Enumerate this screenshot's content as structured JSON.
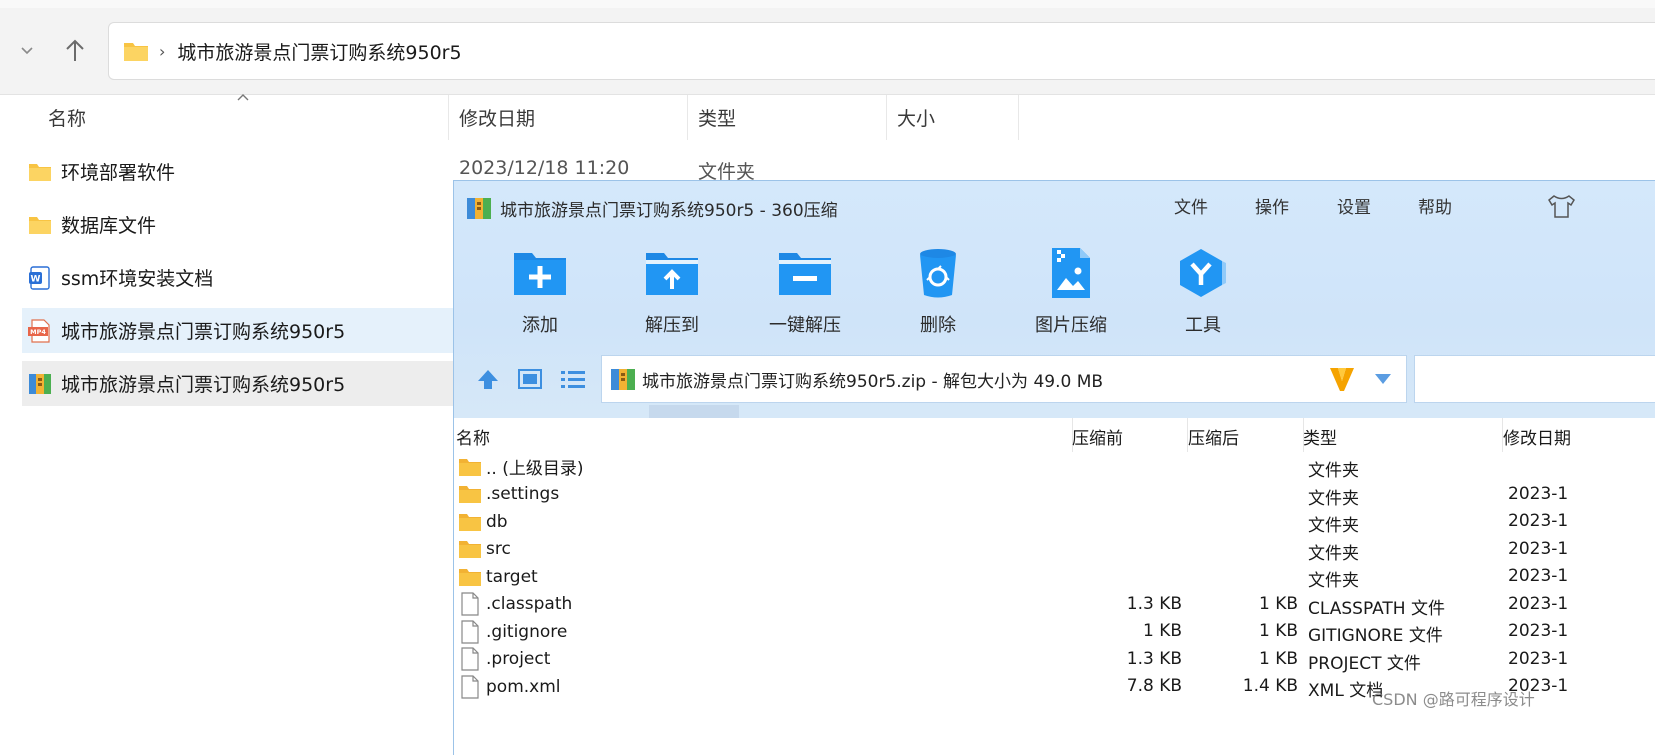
{
  "explorer": {
    "breadcrumb": "城市旅游景点门票订购系统950r5",
    "columns": [
      "名称",
      "修改日期",
      "类型",
      "大小"
    ],
    "visible_meta": {
      "date": "2023/12/18 11:20",
      "type": "文件夹"
    },
    "rows": [
      {
        "name": "环境部署软件",
        "icon": "folder-icon"
      },
      {
        "name": "数据库文件",
        "icon": "folder-icon"
      },
      {
        "name": "ssm环境安装文档",
        "icon": "word-doc-icon"
      },
      {
        "name": "城市旅游景点门票订购系统950r5",
        "icon": "mp4-file-icon"
      },
      {
        "name": "城市旅游景点门票订购系统950r5",
        "icon": "zip-archive-icon"
      }
    ]
  },
  "zip": {
    "title": "城市旅游景点门票订购系统950r5 - 360压缩",
    "menu": [
      "文件",
      "操作",
      "设置",
      "帮助"
    ],
    "tools": [
      {
        "label": "添加",
        "icon": "add-folder-icon"
      },
      {
        "label": "解压到",
        "icon": "extract-to-icon"
      },
      {
        "label": "一键解压",
        "icon": "one-click-extract-icon"
      },
      {
        "label": "删除",
        "icon": "delete-bin-icon"
      },
      {
        "label": "图片压缩",
        "icon": "image-compress-icon"
      },
      {
        "label": "工具",
        "icon": "tools-icon"
      }
    ],
    "path": "城市旅游景点门票订购系统950r5.zip - 解包大小为 49.0 MB",
    "columns": [
      "名称",
      "压缩前",
      "压缩后",
      "类型",
      "修改日期"
    ],
    "rows": [
      {
        "name": ".. (上级目录)",
        "icon": "folder-icon",
        "before": "",
        "after": "",
        "type": "文件夹",
        "date": ""
      },
      {
        "name": ".settings",
        "icon": "folder-icon",
        "before": "",
        "after": "",
        "type": "文件夹",
        "date": "2023-1"
      },
      {
        "name": "db",
        "icon": "folder-icon",
        "before": "",
        "after": "",
        "type": "文件夹",
        "date": "2023-1"
      },
      {
        "name": "src",
        "icon": "folder-icon",
        "before": "",
        "after": "",
        "type": "文件夹",
        "date": "2023-1"
      },
      {
        "name": "target",
        "icon": "folder-icon",
        "before": "",
        "after": "",
        "type": "文件夹",
        "date": "2023-1"
      },
      {
        "name": ".classpath",
        "icon": "file-icon",
        "before": "1.3 KB",
        "after": "1 KB",
        "type": "CLASSPATH 文件",
        "date": "2023-1"
      },
      {
        "name": ".gitignore",
        "icon": "file-icon",
        "before": "1 KB",
        "after": "1 KB",
        "type": "GITIGNORE 文件",
        "date": "2023-1"
      },
      {
        "name": ".project",
        "icon": "file-icon",
        "before": "1.3 KB",
        "after": "1 KB",
        "type": "PROJECT 文件",
        "date": "2023-1"
      },
      {
        "name": "pom.xml",
        "icon": "file-icon",
        "before": "7.8 KB",
        "after": "1.4 KB",
        "type": "XML 文档",
        "date": "2023-1"
      }
    ]
  },
  "watermark": "CSDN @路可程序设计",
  "colors": {
    "folder": "#f8c443",
    "accent": "#1e88e5",
    "zip_bg": "#d2e6fa",
    "selected": "#e5f1fb"
  }
}
